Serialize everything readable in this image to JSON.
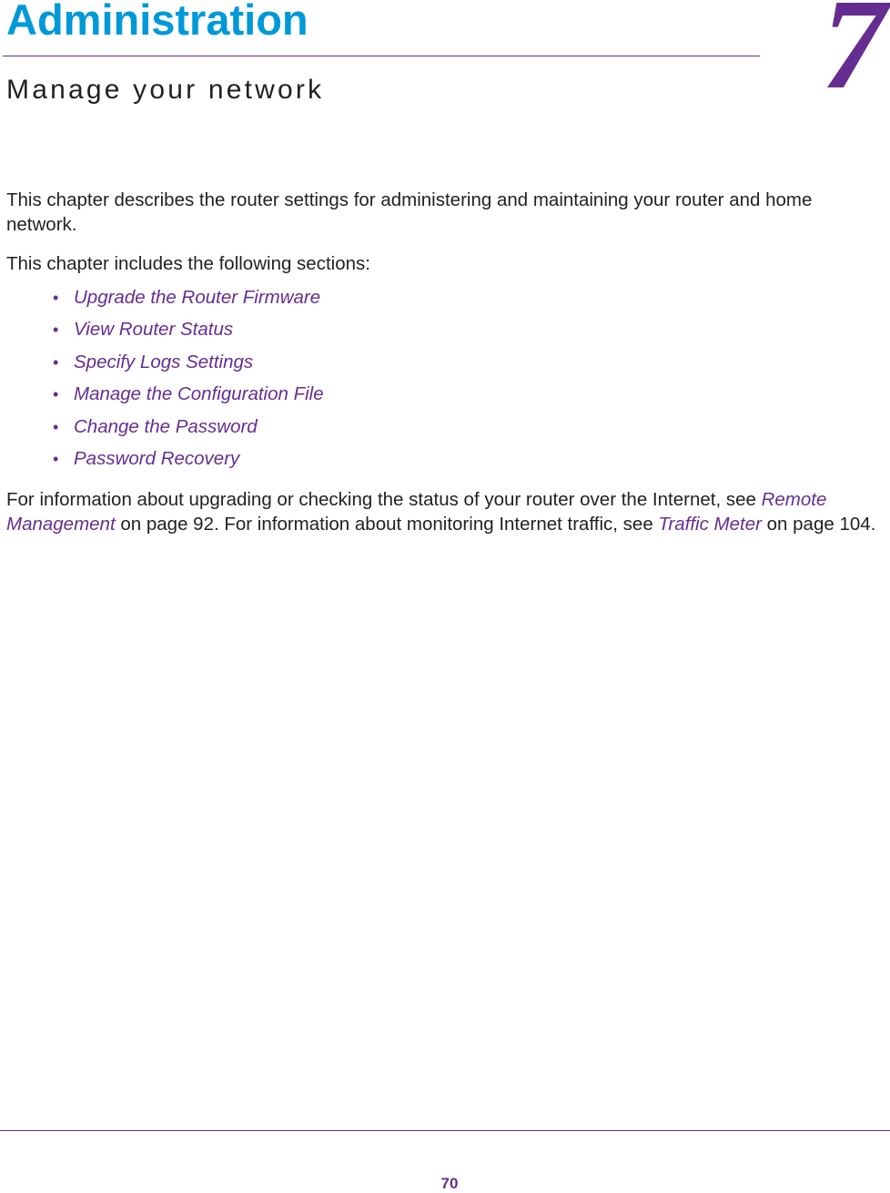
{
  "chapter": {
    "title": "Administration",
    "number": "7",
    "subtitle": "Manage your network"
  },
  "intro": {
    "paragraph1": "This chapter describes the router settings for administering and maintaining your router and home network.",
    "paragraph2": "This chapter includes the following sections:"
  },
  "sections": [
    {
      "bullet": "•",
      "label": "Upgrade the Router Firmware"
    },
    {
      "bullet": "•",
      "label": "View Router Status"
    },
    {
      "bullet": "•",
      "label": "Specify Logs Settings"
    },
    {
      "bullet": "•",
      "label": "Manage the Configuration File"
    },
    {
      "bullet": "•",
      "label": "Change the Password"
    },
    {
      "bullet": "•",
      "label": "Password Recovery"
    }
  ],
  "closing": {
    "text1": "For information about upgrading or checking the status of your router over the Internet, see ",
    "link1": "Remote Management",
    "text2": " on page 92. For information about monitoring Internet traffic, see ",
    "link2": "Traffic Meter",
    "text3": " on page 104."
  },
  "footer": {
    "page_number": "70"
  },
  "colors": {
    "title_blue": "#0099d8",
    "accent_purple": "#662d91",
    "body_text": "#231f20"
  }
}
